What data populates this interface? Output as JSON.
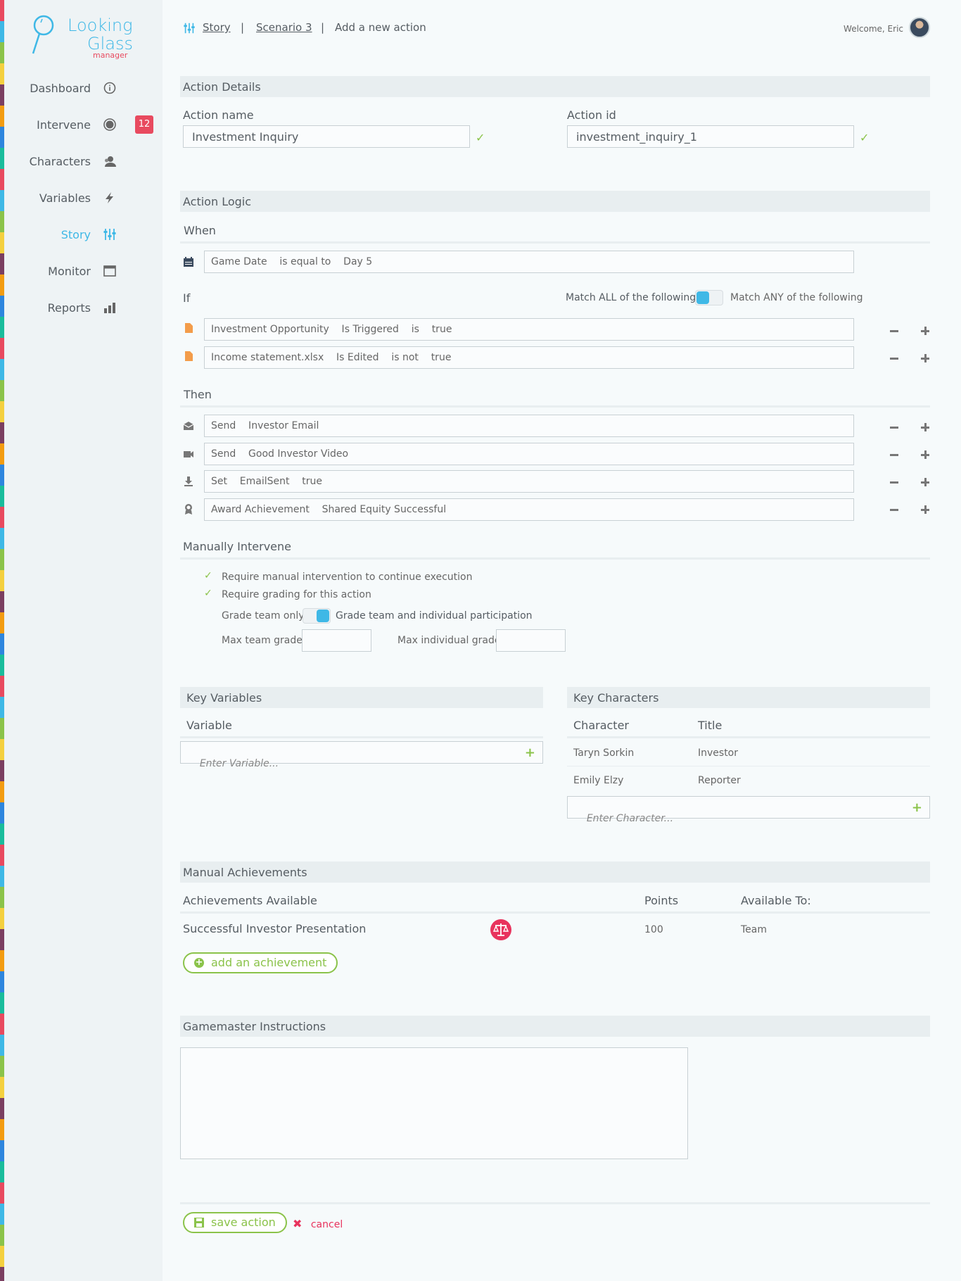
{
  "brand": {
    "line1": "Looking",
    "line2": "Glass",
    "line3": "manager"
  },
  "nav": [
    {
      "label": "Dashboard",
      "icon": "info-icon"
    },
    {
      "label": "Intervene",
      "icon": "record-icon",
      "badge": "12"
    },
    {
      "label": "Characters",
      "icon": "users-icon"
    },
    {
      "label": "Variables",
      "icon": "bolt-icon"
    },
    {
      "label": "Story",
      "icon": "sliders-icon",
      "active": true
    },
    {
      "label": "Monitor",
      "icon": "window-icon"
    },
    {
      "label": "Reports",
      "icon": "bar-chart-icon"
    }
  ],
  "breadcrumb": {
    "story": "Story",
    "scenario": "Scenario 3",
    "current": "Add a new action",
    "sep": "|"
  },
  "user": {
    "welcome": "Welcome, Eric"
  },
  "action_details": {
    "title": "Action Details",
    "name_label": "Action name",
    "name_value": "Investment Inquiry",
    "id_label": "Action id",
    "id_value": "investment_inquiry_1"
  },
  "action_logic": {
    "title": "Action Logic",
    "when_label": "When",
    "when_row": "Game Date    is equal to    Day 5",
    "if_label": "If",
    "match_all": "Match ALL of the following",
    "match_any": "Match ANY of the following",
    "if_rows": [
      "Investment Opportunity    Is Triggered    is    true",
      "Income statement.xlsx    Is Edited    is not    true"
    ],
    "then_label": "Then",
    "then_rows": [
      "Send    Investor Email",
      "Send    Good Investor Video",
      "Set    EmailSent    true",
      "Award Achievement    Shared Equity Successful"
    ],
    "manual_label": "Manually Intervene",
    "require_manual": "Require manual intervention to continue execution",
    "require_grading": "Require grading for this action",
    "grade_team_only": "Grade team only",
    "grade_team_individual": "Grade team and individual participation",
    "max_team_grade": "Max team grade",
    "max_individual_grade": "Max individual grade"
  },
  "key_variables": {
    "title": "Key Variables",
    "column": "Variable",
    "placeholder": "Enter Variable..."
  },
  "key_characters": {
    "title": "Key Characters",
    "col_character": "Character",
    "col_title": "Title",
    "rows": [
      {
        "name": "Taryn Sorkin",
        "title": "Investor"
      },
      {
        "name": "Emily Elzy",
        "title": "Reporter"
      }
    ],
    "placeholder": "Enter Character..."
  },
  "achievements": {
    "title": "Manual Achievements",
    "col_available": "Achievements Available",
    "col_points": "Points",
    "col_to": "Available To:",
    "rows": [
      {
        "name": "Successful Investor Presentation",
        "points": "100",
        "to": "Team"
      }
    ],
    "add_label": "add an achievement"
  },
  "instructions": {
    "title": "Gamemaster Instructions"
  },
  "footer": {
    "save": "save action",
    "cancel": "cancel"
  },
  "colors": {
    "accent": "#3fb8e6",
    "success": "#8bc34a",
    "danger": "#e84a5f",
    "orange": "#f39c4a"
  }
}
